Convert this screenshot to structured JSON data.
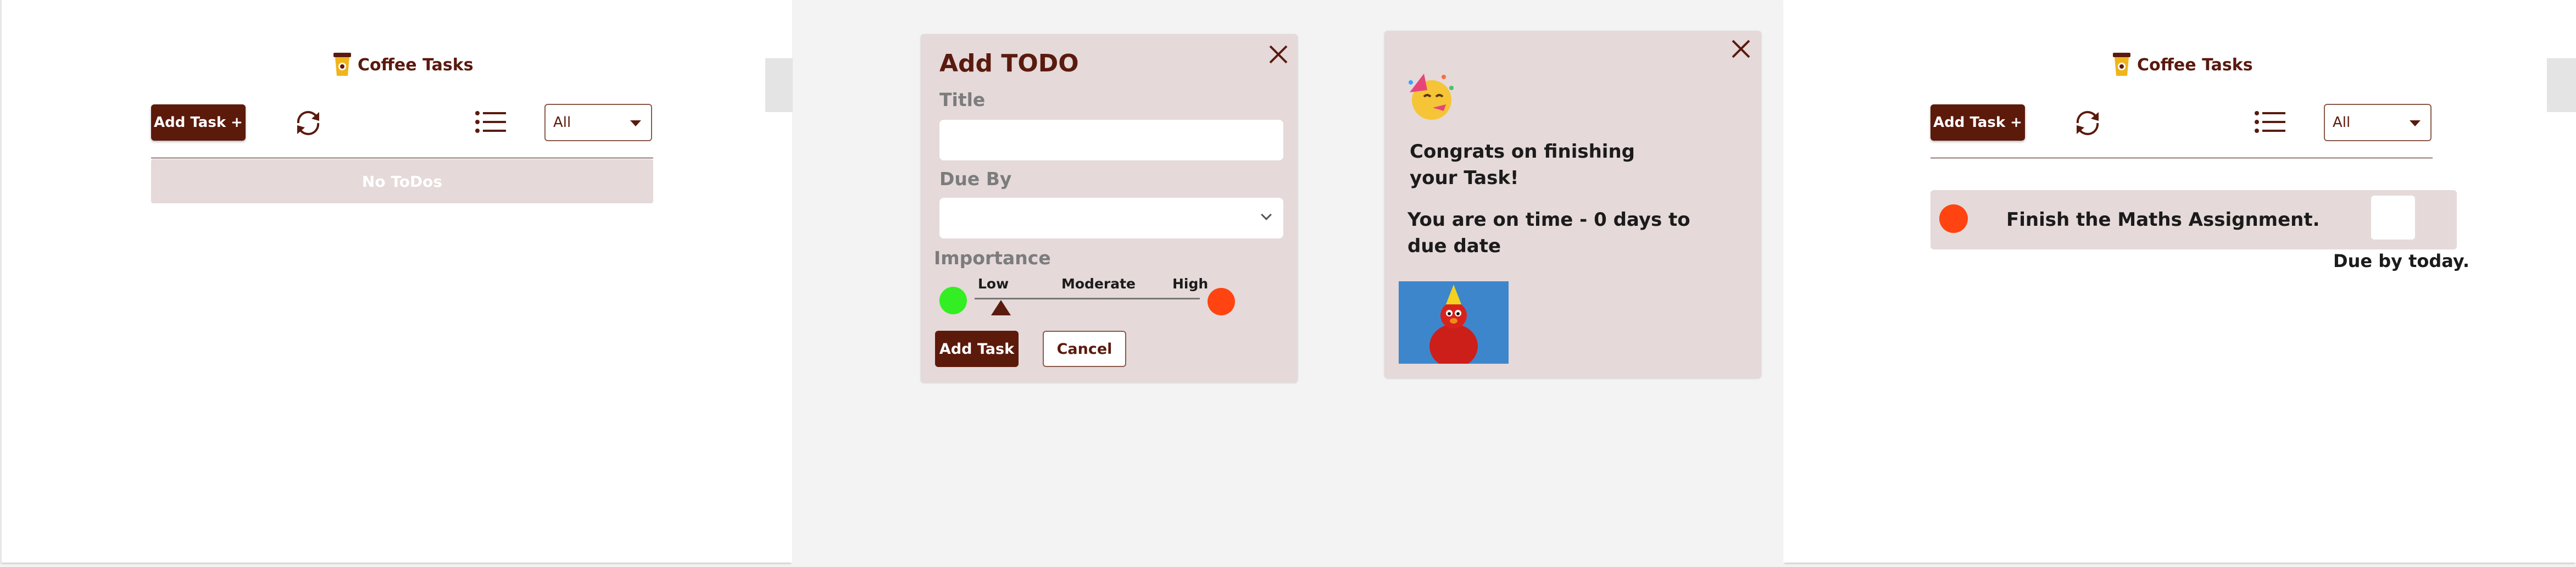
{
  "app": {
    "title": "Coffee Tasks"
  },
  "toolbar": {
    "add_label": "Add Task +",
    "filter_value": "All",
    "icons": [
      "coffee-cup-icon",
      "refresh-icon",
      "list-icon",
      "caret-down-icon"
    ]
  },
  "screen1": {
    "empty_text": "No ToDos"
  },
  "add_modal": {
    "title": "Add TODO",
    "title_label": "Title",
    "title_value": "",
    "due_label": "Due By",
    "due_value": "",
    "importance_label": "Importance",
    "levels": [
      "Low",
      "Moderate",
      "High"
    ],
    "selected_level": "Low",
    "submit_label": "Add Task",
    "cancel_label": "Cancel"
  },
  "congrats": {
    "line1": "Congrats on finishing",
    "line2": "your Task!",
    "line3": "You are on time - 0 days to",
    "line4": "due date",
    "emoji": "🥳"
  },
  "screen3": {
    "task": {
      "title": "Finish the Maths Assignment.",
      "due": "Due by today.",
      "priority": "High"
    }
  },
  "colors": {
    "brand": "#5c1a0b",
    "card": "#e5d9d9",
    "low": "#33ee22",
    "high": "#ff4411"
  }
}
